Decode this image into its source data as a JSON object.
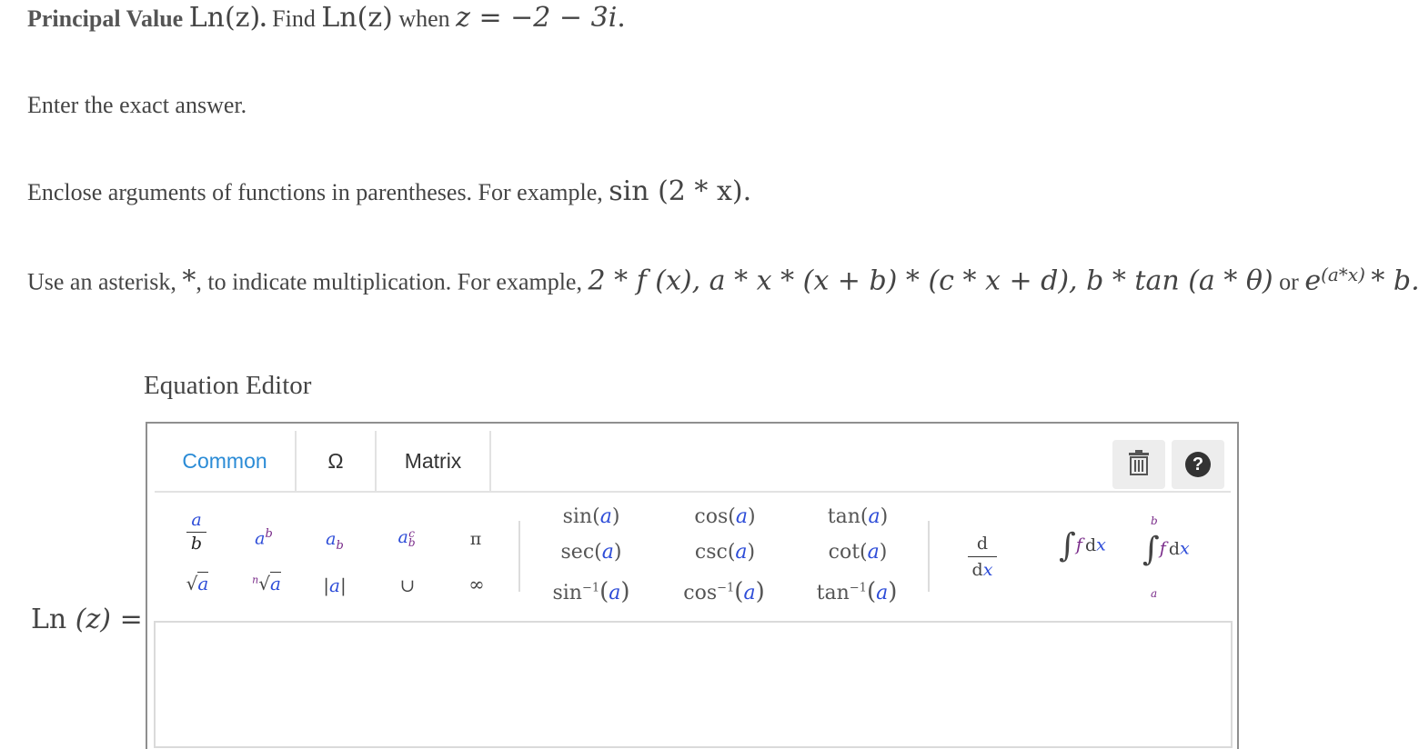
{
  "question": {
    "bold_label": "Principal Value",
    "ln": "Ln",
    "z_arg": "(z)",
    "period": ".",
    "find_text": "Find",
    "when_text": "when",
    "z_eq": "z = −2 − 3i",
    "end": "."
  },
  "instructions": {
    "exact": "Enter the exact answer.",
    "enclose_text": "Enclose arguments of functions in parentheses. For example,",
    "enclose_example": "sin (2 * x).",
    "asterisk_text_1": "Use an asterisk,",
    "asterisk_symbol": "*",
    "asterisk_text_2": ", to indicate multiplication. For example,",
    "mult_example": "2 * f (x), a * x * (x + b) * (c * x + d), b * tan (a * θ)",
    "or_text": "or",
    "exp_base": "e",
    "exp_power": "(a*x)",
    "exp_tail": "* b."
  },
  "editor": {
    "title": "Equation Editor",
    "tabs": [
      "Common",
      "Ω",
      "Matrix"
    ],
    "trash_icon": "trash-icon",
    "help_icon": "question-circle-icon",
    "help_glyph": "?",
    "palette": {
      "frac_num": "a",
      "frac_den": "b",
      "pow_base": "a",
      "pow_exp": "b",
      "sub_base": "a",
      "sub_idx": "b",
      "subsup_base": "a",
      "subsup_sup": "c",
      "subsup_sub": "b",
      "pi": "π",
      "sqrt": "√",
      "sqrt_arg": "a",
      "nroot_idx": "n",
      "abs_bar": "|",
      "abs_arg": "a",
      "union": "∪",
      "infinity": "∞",
      "arg": "a",
      "trig": [
        "sin",
        "cos",
        "tan",
        "sec",
        "csc",
        "cot"
      ],
      "inv_sup": "−1",
      "deriv_d": "d",
      "deriv_dx_d": "d",
      "deriv_x": "x",
      "integral": "∫",
      "integrand_f": "f",
      "integrand_d": "d",
      "integrand_x": "x",
      "upper_limit": "b",
      "lower_limit": "a"
    }
  },
  "answer": {
    "label_ln": "Ln",
    "label_arg": "(z)",
    "label_eq": "=",
    "value": ""
  }
}
